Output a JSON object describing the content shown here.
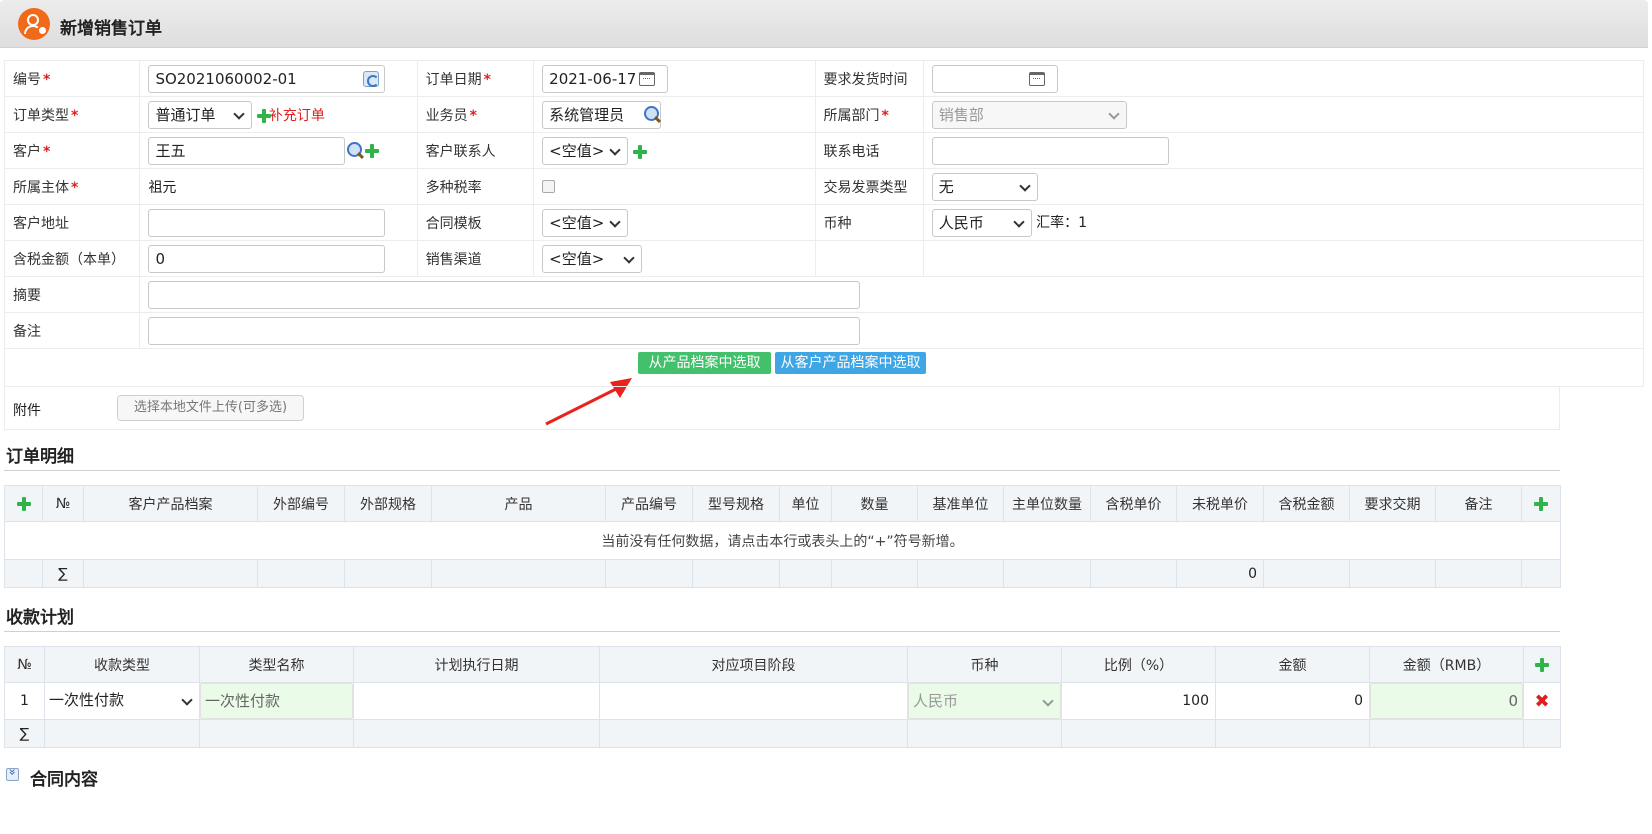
{
  "window": {
    "title": "新增销售订单"
  },
  "form": {
    "order_no": {
      "label": "编号",
      "value": "SO2021060002-01"
    },
    "order_date": {
      "label": "订单日期",
      "value": "2021-06-17"
    },
    "ship_time": {
      "label": "要求发货时间",
      "value": ""
    },
    "order_type": {
      "label": "订单类型",
      "value": "普通订单",
      "add_link": "补充订单"
    },
    "salesman": {
      "label": "业务员",
      "value": "系统管理员"
    },
    "department": {
      "label": "所属部门",
      "value": "销售部"
    },
    "customer": {
      "label": "客户",
      "value": "王五"
    },
    "contact": {
      "label": "客户联系人",
      "value": "<空值>"
    },
    "phone": {
      "label": "联系电话",
      "value": ""
    },
    "entity": {
      "label": "所属主体",
      "value": "祖元"
    },
    "multi_tax": {
      "label": "多种税率"
    },
    "invoice_type": {
      "label": "交易发票类型",
      "value": "无"
    },
    "address": {
      "label": "客户地址",
      "value": ""
    },
    "contract_template": {
      "label": "合同模板",
      "value": "<空值>"
    },
    "currency": {
      "label": "币种",
      "value": "人民币",
      "rate_text": "汇率：1"
    },
    "amount": {
      "label": "含税金额（本单）",
      "value": "0"
    },
    "channel": {
      "label": "销售渠道",
      "value": "<空值>"
    },
    "summary": {
      "label": "摘要",
      "value": ""
    },
    "remark": {
      "label": "备注",
      "value": ""
    }
  },
  "actions": {
    "pick_product": "从产品档案中选取",
    "pick_customer_product": "从客户产品档案中选取"
  },
  "attachment": {
    "label": "附件",
    "upload": "选择本地文件上传(可多选)"
  },
  "order_detail": {
    "title": "订单明细",
    "columns": [
      "№",
      "客户产品档案",
      "外部编号",
      "外部规格",
      "产品",
      "产品编号",
      "型号规格",
      "单位",
      "数量",
      "基准单位",
      "主单位数量",
      "含税单价",
      "未税单价",
      "含税金额",
      "要求交期",
      "备注"
    ],
    "empty_message": "当前没有任何数据，请点击本行或表头上的“+”符号新增。",
    "sum_symbol": "∑",
    "sum_amount": "0"
  },
  "payment_plan": {
    "title": "收款计划",
    "columns": [
      "№",
      "收款类型",
      "类型名称",
      "计划执行日期",
      "对应项目阶段",
      "币种",
      "比例（%）",
      "金额",
      "金额（RMB）"
    ],
    "rows": [
      {
        "no": "1",
        "type": "一次性付款",
        "type_name": "一次性付款",
        "date": "",
        "stage": "",
        "currency": "人民币",
        "ratio": "100",
        "amount": "0",
        "amount_rmb": "0"
      }
    ],
    "sum_symbol": "∑"
  },
  "contract": {
    "title": "合同内容"
  },
  "colors": {
    "green": "#43c06b",
    "blue": "#3fa6e6",
    "required": "#e02020",
    "logo": "#f06a1a"
  }
}
